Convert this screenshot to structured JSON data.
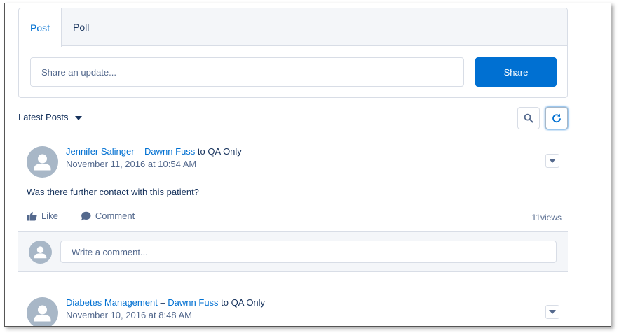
{
  "publisher": {
    "tabs": [
      {
        "label": "Post"
      },
      {
        "label": "Poll"
      }
    ],
    "input_placeholder": "Share an update...",
    "share_label": "Share"
  },
  "feed": {
    "sort_label": "Latest Posts"
  },
  "posts": [
    {
      "author": "Jennifer Salinger",
      "separator": "–",
      "recipient": "Dawnn Fuss",
      "to_text": "to",
      "group": "QA Only",
      "date": "November 11, 2016 at 10:54 AM",
      "body": "Was there further contact with this patient?",
      "like_label": "Like",
      "comment_label": "Comment",
      "views_count": "11",
      "views_label": "views",
      "comment_placeholder": "Write a comment..."
    },
    {
      "author": "Diabetes Management",
      "separator": "–",
      "recipient": "Dawnn Fuss",
      "to_text": "to",
      "group": "QA Only",
      "date": "November 10, 2016 at 8:48 AM"
    }
  ],
  "colors": {
    "brand": "#0070d2",
    "text": "#16325c",
    "muted": "#54698d",
    "border": "#d8dde6",
    "avatar": "#a8b7c7"
  }
}
